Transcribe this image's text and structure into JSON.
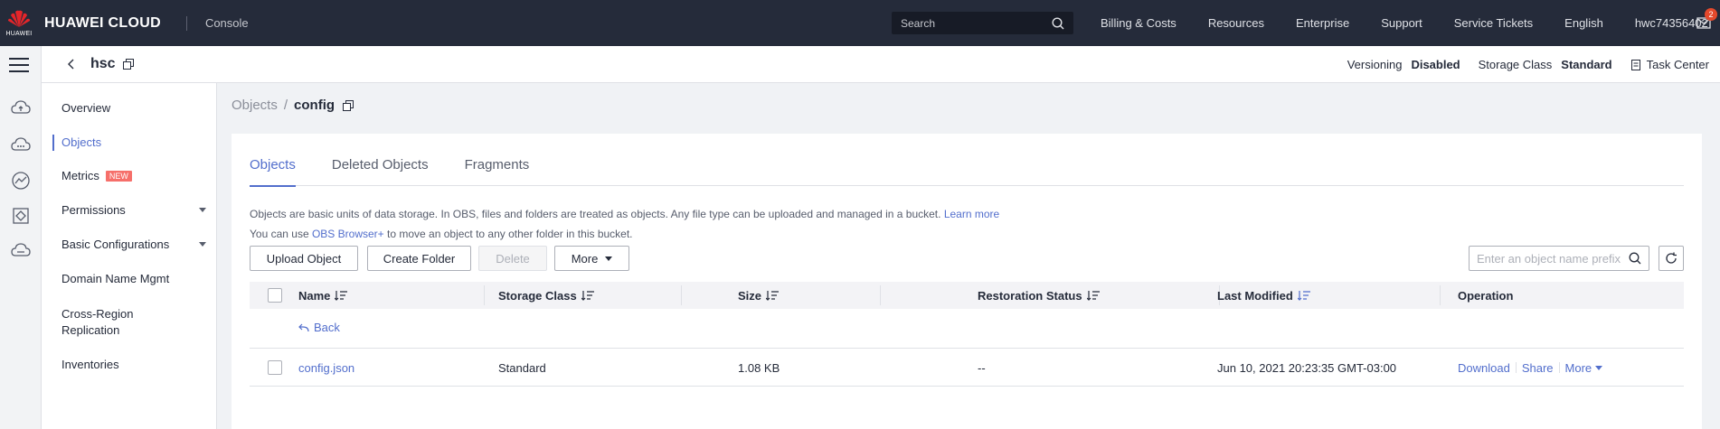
{
  "topbar": {
    "logo_text": "HUAWEI",
    "brand": "HUAWEI CLOUD",
    "console": "Console",
    "search_placeholder": "Search",
    "nav": [
      "Billing & Costs",
      "Resources",
      "Enterprise",
      "Support",
      "Service Tickets",
      "English",
      "hwc74356402"
    ],
    "mail_count": "2"
  },
  "subheader": {
    "bucket_name": "hsc",
    "versioning_label": "Versioning",
    "versioning_value": "Disabled",
    "storage_class_label": "Storage Class",
    "storage_class_value": "Standard",
    "task_center": "Task Center"
  },
  "sidenav": {
    "items": [
      {
        "label": "Overview"
      },
      {
        "label": "Objects"
      },
      {
        "label": "Metrics",
        "badge": "NEW"
      },
      {
        "label": "Permissions"
      },
      {
        "label": "Basic Configurations"
      },
      {
        "label": "Domain Name Mgmt"
      },
      {
        "label": "Cross-Region Replication"
      },
      {
        "label": "Inventories"
      }
    ]
  },
  "breadcrumb": {
    "root": "Objects",
    "separator": "/",
    "current": "config"
  },
  "tabs": [
    "Objects",
    "Deleted Objects",
    "Fragments"
  ],
  "info": {
    "line1": "Objects are basic units of data storage. In OBS, files and folders are treated as objects. Any file type can be uploaded and managed in a bucket.",
    "learn_more": "Learn more",
    "line2_prefix": "You can use",
    "obs_browser": "OBS Browser+",
    "line2_suffix": "to move an object to any other folder in this bucket."
  },
  "toolbar": {
    "upload": "Upload Object",
    "create_folder": "Create Folder",
    "delete": "Delete",
    "more": "More",
    "filter_placeholder": "Enter an object name prefix"
  },
  "table": {
    "columns": [
      "Name",
      "Storage Class",
      "Size",
      "Restoration Status",
      "Last Modified",
      "Operation"
    ],
    "back_label": "Back",
    "rows": [
      {
        "name": "config.json",
        "storage_class": "Standard",
        "size": "1.08 KB",
        "restoration": "--",
        "last_modified": "Jun 10, 2021 20:23:35 GMT-03:00",
        "ops": [
          "Download",
          "Share",
          "More"
        ]
      }
    ]
  },
  "colors": {
    "topbar": "#252b3a",
    "accent": "#526ecc",
    "new_badge": "#f66f6a"
  }
}
